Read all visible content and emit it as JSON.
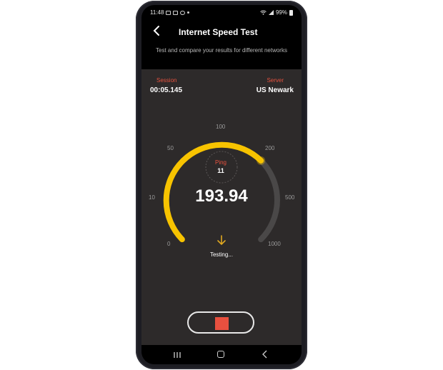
{
  "status_bar": {
    "time": "11:48",
    "battery": "99%"
  },
  "header": {
    "title": "Internet Speed Test",
    "back_icon": "chevron-left-icon"
  },
  "subtitle": "Test and compare your results for different networks",
  "session": {
    "label": "Session",
    "value": "00:05.145"
  },
  "server": {
    "label": "Server",
    "value": "US Newark"
  },
  "gauge": {
    "ticks": [
      "0",
      "10",
      "50",
      "100",
      "200",
      "500",
      "1000"
    ],
    "progress_tick": "200",
    "speed": "193.94",
    "ping_label": "Ping",
    "ping_value": "11",
    "status": "Testing...",
    "colors": {
      "active": "#f7c300",
      "track": "#4a4848",
      "accent": "#e8523f"
    }
  },
  "stop_button": {
    "icon": "stop-square-icon"
  },
  "nav": {
    "recent": "recent-apps-icon",
    "home": "home-icon",
    "back": "back-icon"
  }
}
